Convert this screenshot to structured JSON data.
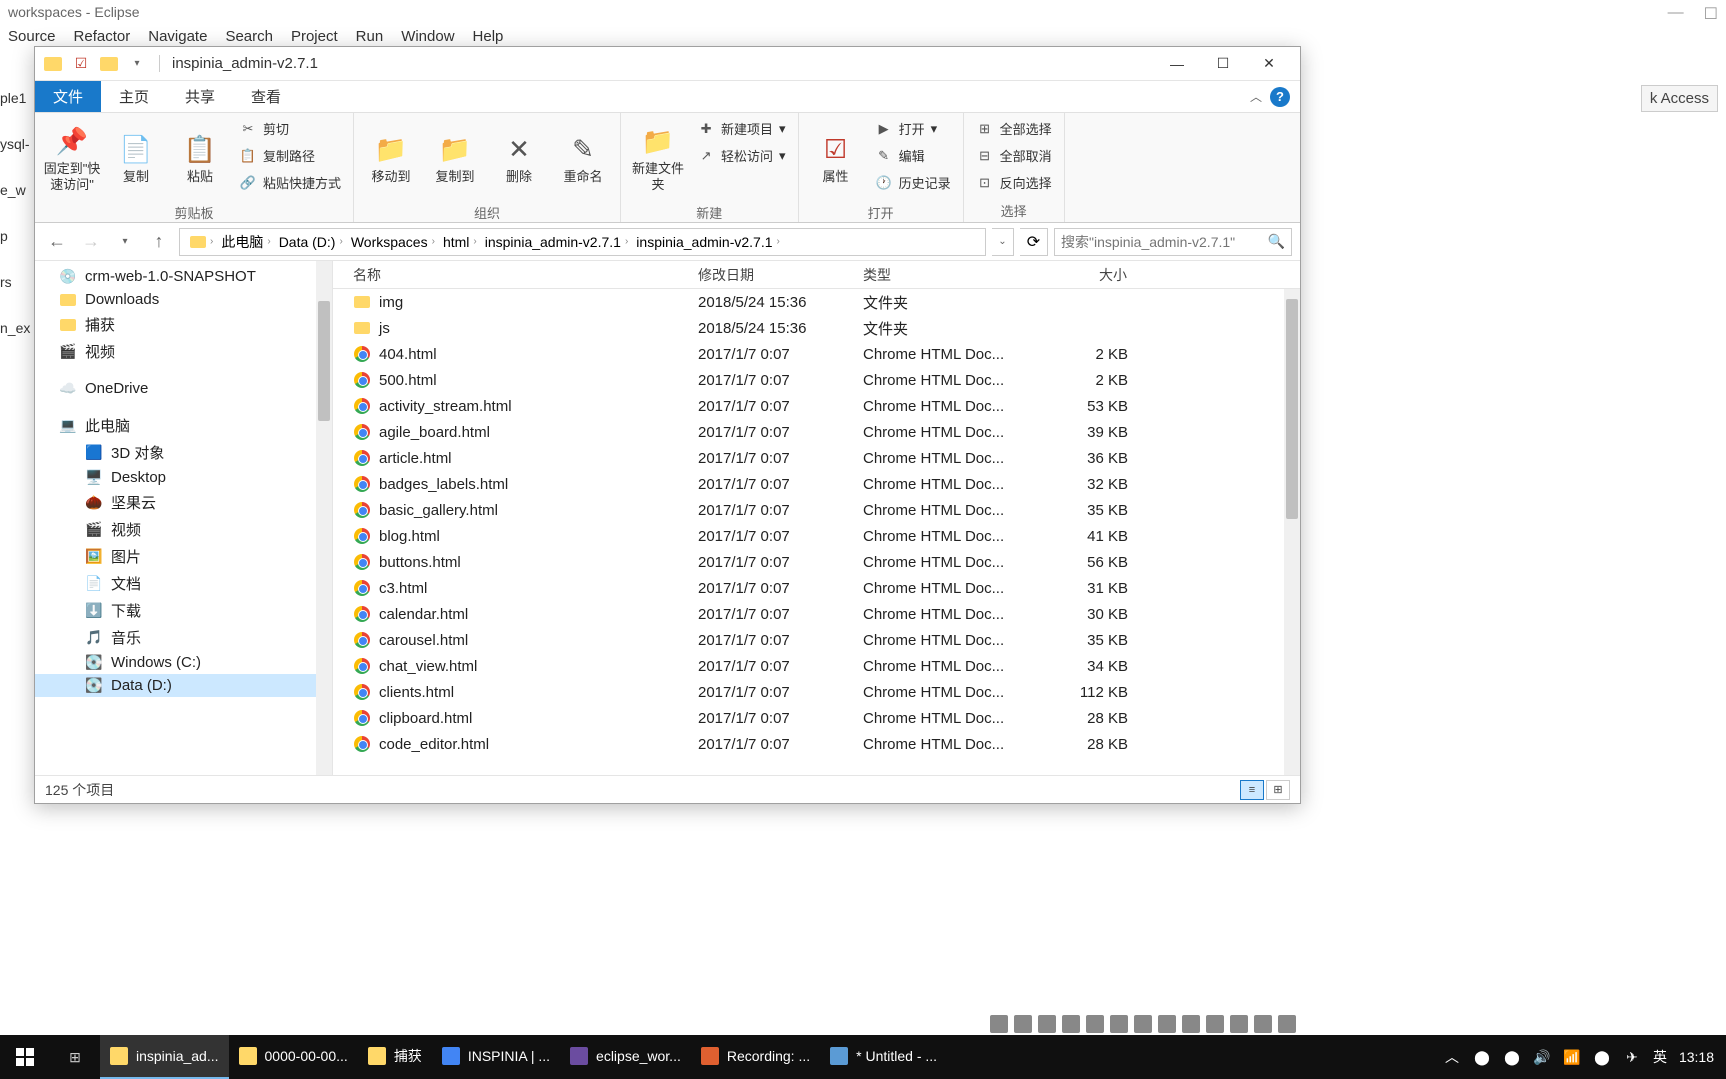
{
  "eclipse": {
    "title": "workspaces - Eclipse",
    "menu": [
      "Source",
      "Refactor",
      "Navigate",
      "Search",
      "Project",
      "Run",
      "Window",
      "Help"
    ],
    "quick_access": "k Access",
    "sidebar_fragments": [
      "ple1",
      "ysql-",
      "e_w",
      "p",
      "rs",
      "n_ex"
    ]
  },
  "explorer": {
    "title": "inspinia_admin-v2.7.1",
    "tabs": {
      "file": "文件",
      "home": "主页",
      "share": "共享",
      "view": "查看"
    },
    "ribbon": {
      "clipboard": {
        "label": "剪贴板",
        "pin": "固定到\"快速访问\"",
        "copy": "复制",
        "paste": "粘贴",
        "cut": "剪切",
        "copypath": "复制路径",
        "pasteshortcut": "粘贴快捷方式"
      },
      "organize": {
        "label": "组织",
        "moveto": "移动到",
        "copyto": "复制到",
        "delete": "删除",
        "rename": "重命名"
      },
      "new": {
        "label": "新建",
        "newfolder": "新建文件夹",
        "newitem": "新建项目",
        "easyaccess": "轻松访问"
      },
      "open": {
        "label": "打开",
        "properties": "属性",
        "open": "打开",
        "edit": "编辑",
        "history": "历史记录"
      },
      "select": {
        "label": "选择",
        "selectall": "全部选择",
        "selectnone": "全部取消",
        "invert": "反向选择"
      }
    },
    "breadcrumb": [
      "此电脑",
      "Data (D:)",
      "Workspaces",
      "html",
      "inspinia_admin-v2.7.1",
      "inspinia_admin-v2.7.1"
    ],
    "search_placeholder": "搜索\"inspinia_admin-v2.7.1\"",
    "columns": {
      "name": "名称",
      "date": "修改日期",
      "type": "类型",
      "size": "大小"
    },
    "tree": [
      {
        "label": "crm-web-1.0-SNAPSHOT",
        "icon": "disc",
        "indent": 0
      },
      {
        "label": "Downloads",
        "icon": "folder",
        "indent": 0
      },
      {
        "label": "捕获",
        "icon": "folder",
        "indent": 0
      },
      {
        "label": "视频",
        "icon": "video",
        "indent": 0
      },
      {
        "spacer": true
      },
      {
        "label": "OneDrive",
        "icon": "cloud",
        "indent": 0
      },
      {
        "spacer": true
      },
      {
        "label": "此电脑",
        "icon": "pc",
        "indent": 0
      },
      {
        "label": "3D 对象",
        "icon": "3d",
        "indent": 1
      },
      {
        "label": "Desktop",
        "icon": "desktop",
        "indent": 1
      },
      {
        "label": "坚果云",
        "icon": "nut",
        "indent": 1
      },
      {
        "label": "视频",
        "icon": "video",
        "indent": 1
      },
      {
        "label": "图片",
        "icon": "pictures",
        "indent": 1
      },
      {
        "label": "文档",
        "icon": "documents",
        "indent": 1
      },
      {
        "label": "下载",
        "icon": "downloads",
        "indent": 1
      },
      {
        "label": "音乐",
        "icon": "music",
        "indent": 1
      },
      {
        "label": "Windows (C:)",
        "icon": "drive",
        "indent": 1
      },
      {
        "label": "Data (D:)",
        "icon": "drive",
        "indent": 1,
        "selected": true
      }
    ],
    "files": [
      {
        "name": "img",
        "date": "2018/5/24 15:36",
        "type": "文件夹",
        "size": "",
        "icon": "folder"
      },
      {
        "name": "js",
        "date": "2018/5/24 15:36",
        "type": "文件夹",
        "size": "",
        "icon": "folder"
      },
      {
        "name": "404.html",
        "date": "2017/1/7 0:07",
        "type": "Chrome HTML Doc...",
        "size": "2 KB",
        "icon": "chrome"
      },
      {
        "name": "500.html",
        "date": "2017/1/7 0:07",
        "type": "Chrome HTML Doc...",
        "size": "2 KB",
        "icon": "chrome"
      },
      {
        "name": "activity_stream.html",
        "date": "2017/1/7 0:07",
        "type": "Chrome HTML Doc...",
        "size": "53 KB",
        "icon": "chrome"
      },
      {
        "name": "agile_board.html",
        "date": "2017/1/7 0:07",
        "type": "Chrome HTML Doc...",
        "size": "39 KB",
        "icon": "chrome"
      },
      {
        "name": "article.html",
        "date": "2017/1/7 0:07",
        "type": "Chrome HTML Doc...",
        "size": "36 KB",
        "icon": "chrome"
      },
      {
        "name": "badges_labels.html",
        "date": "2017/1/7 0:07",
        "type": "Chrome HTML Doc...",
        "size": "32 KB",
        "icon": "chrome"
      },
      {
        "name": "basic_gallery.html",
        "date": "2017/1/7 0:07",
        "type": "Chrome HTML Doc...",
        "size": "35 KB",
        "icon": "chrome"
      },
      {
        "name": "blog.html",
        "date": "2017/1/7 0:07",
        "type": "Chrome HTML Doc...",
        "size": "41 KB",
        "icon": "chrome"
      },
      {
        "name": "buttons.html",
        "date": "2017/1/7 0:07",
        "type": "Chrome HTML Doc...",
        "size": "56 KB",
        "icon": "chrome"
      },
      {
        "name": "c3.html",
        "date": "2017/1/7 0:07",
        "type": "Chrome HTML Doc...",
        "size": "31 KB",
        "icon": "chrome"
      },
      {
        "name": "calendar.html",
        "date": "2017/1/7 0:07",
        "type": "Chrome HTML Doc...",
        "size": "30 KB",
        "icon": "chrome"
      },
      {
        "name": "carousel.html",
        "date": "2017/1/7 0:07",
        "type": "Chrome HTML Doc...",
        "size": "35 KB",
        "icon": "chrome"
      },
      {
        "name": "chat_view.html",
        "date": "2017/1/7 0:07",
        "type": "Chrome HTML Doc...",
        "size": "34 KB",
        "icon": "chrome"
      },
      {
        "name": "clients.html",
        "date": "2017/1/7 0:07",
        "type": "Chrome HTML Doc...",
        "size": "112 KB",
        "icon": "chrome"
      },
      {
        "name": "clipboard.html",
        "date": "2017/1/7 0:07",
        "type": "Chrome HTML Doc...",
        "size": "28 KB",
        "icon": "chrome"
      },
      {
        "name": "code_editor.html",
        "date": "2017/1/7 0:07",
        "type": "Chrome HTML Doc...",
        "size": "28 KB",
        "icon": "chrome"
      }
    ],
    "status": "125 个项目"
  },
  "taskbar": {
    "items": [
      {
        "label": "inspinia_ad...",
        "color": "#ffd869"
      },
      {
        "label": "0000-00-00...",
        "color": "#ffd869"
      },
      {
        "label": "捕获",
        "color": "#ffd869"
      },
      {
        "label": "INSPINIA | ...",
        "color": "#4285f4"
      },
      {
        "label": "eclipse_wor...",
        "color": "#6b4ca0"
      },
      {
        "label": "Recording: ...",
        "color": "#e06030"
      },
      {
        "label": "* Untitled - ...",
        "color": "#5b9bd5"
      }
    ],
    "ime": "英",
    "time": "13:18"
  }
}
